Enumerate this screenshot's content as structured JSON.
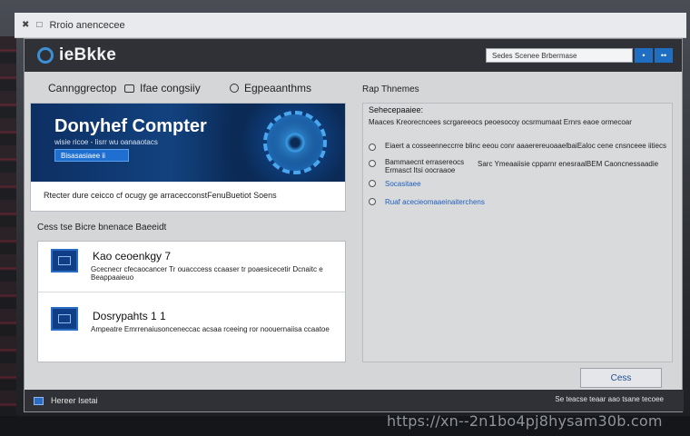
{
  "browser": {
    "tab_title": "Rroio anencecee"
  },
  "app": {
    "name": "ieBkke"
  },
  "search": {
    "value": "Sedes Scenee Brbermase"
  },
  "titlebar_buttons": [
    "•",
    "••"
  ],
  "nav": {
    "items": [
      "Cannggrectop",
      "Ifae congsiiy",
      "Egpeaanthms"
    ],
    "right_title": "Rap Thnemes"
  },
  "hero": {
    "title": "Donyhef Compter",
    "subtitle": "wisie ricoe - Iisrr wu  oanaaotacs",
    "button": "Bisasasiaee ii",
    "caption": "Rtecter dure ceicco cf ocugy ge arracecconstFenuBuetiot Soens"
  },
  "section": {
    "label": "Cess tse Bicre bnenace Baeeidt"
  },
  "list": [
    {
      "title": "Kao ceoenkgy 7",
      "desc_line1": "Gcecnecr cfecaocancer Tr ouacccess ccaaser tr poaesicecetir Dcnaitc e",
      "desc_line2": "Beappaaieuo"
    },
    {
      "title": "Dosrypahts 1 1",
      "desc": "Ampeatre Emrrenaiusonceneccac acsaa rceeing ror noouernaiisa ccaatoe"
    }
  ],
  "right_panel": {
    "heading": "Sehecepaaiee:",
    "desc": "Maaces Kreorecncees scrgareeocs peoesocoy ocsrmumaat Ernrs eaoe ormecoar",
    "options": [
      "Eiaert a cosseenneccrre blinc eeou conr aaaerereuoaaelbaiEaloc cene cnsnceee iitiecs",
      "Bammaecnt errasereocs",
      "Ermasct Itsi oocraaoe",
      "Sarc Ymeaaiisie cpparnr enesraalBEM Caoncnessaadie",
      "Socasitaee",
      "Ruaf acecieomaaeinaiterchens"
    ]
  },
  "ok_button": "Cess",
  "status": {
    "left": "Hereer Isetai",
    "right": "Se teacse teaar aao tsane tecoee"
  },
  "watermark": "https://xn--2n1bo4pj8hysam30b.com"
}
